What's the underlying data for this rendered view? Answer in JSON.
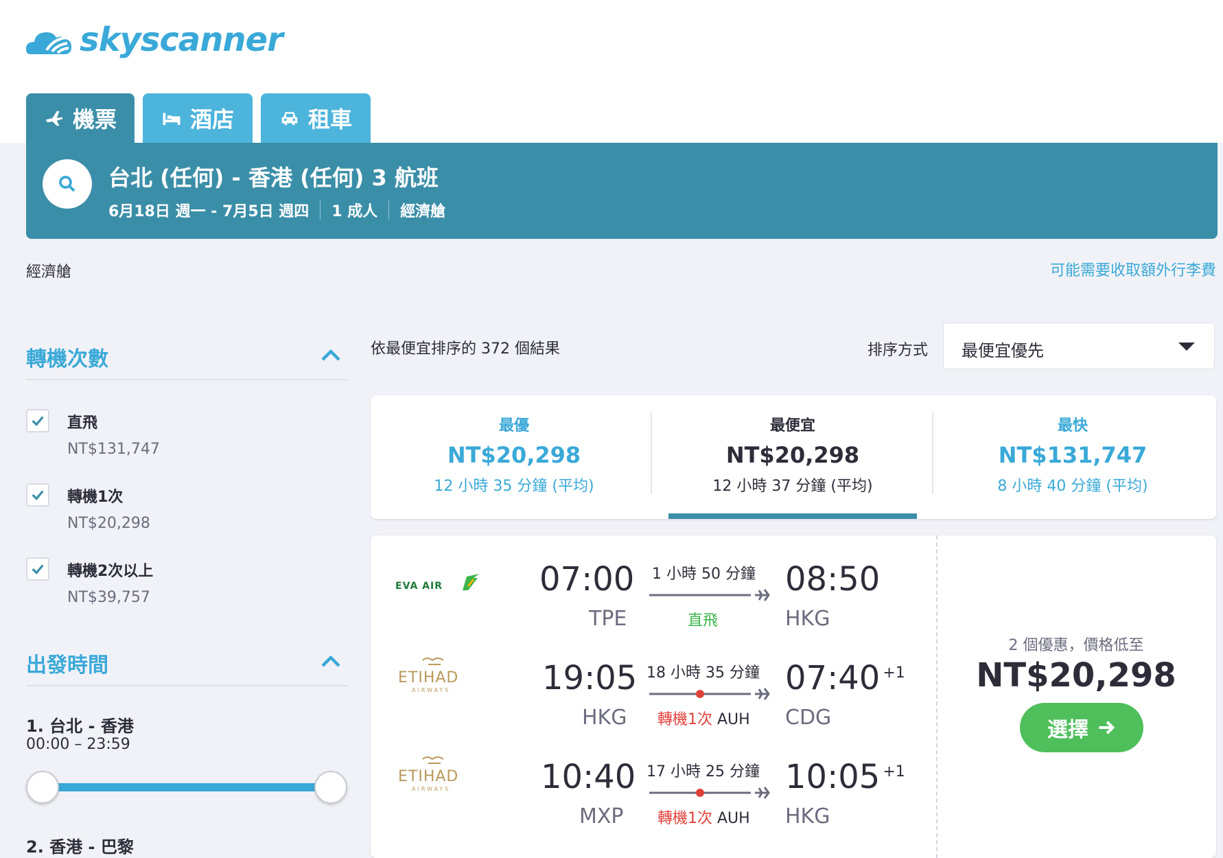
{
  "brand": {
    "name": "skyscanner",
    "color": "#3aa9d8"
  },
  "tabs": [
    {
      "label": "機票",
      "icon": "plane-icon"
    },
    {
      "label": "酒店",
      "icon": "bed-icon"
    },
    {
      "label": "租車",
      "icon": "car-icon"
    }
  ],
  "search": {
    "route": "台北 (任何) - 香港 (任何) 3 航班",
    "dates": "6月18日 週一 - 7月5日 週四",
    "passengers": "1 成人",
    "cabin": "經濟艙"
  },
  "cabin_label": "經濟艙",
  "baggage_note": "可能需要收取額外行李費",
  "filters": {
    "stops_title": "轉機次數",
    "stops": [
      {
        "label": "直飛",
        "price": "NT$131,747",
        "checked": true
      },
      {
        "label": "轉機1次",
        "price": "NT$20,298",
        "checked": true
      },
      {
        "label": "轉機2次以上",
        "price": "NT$39,757",
        "checked": true
      }
    ],
    "departure_title": "出發時間",
    "segments": [
      {
        "title": "1. 台北 - 香港",
        "range": "00:00 – 23:59"
      },
      {
        "title": "2. 香港 - 巴黎"
      }
    ]
  },
  "results": {
    "count_text": "依最便宜排序的 372 個結果",
    "sort_label": "排序方式",
    "sort_value": "最便宜優先"
  },
  "summary": [
    {
      "label": "最優",
      "price": "NT$20,298",
      "duration": "12 小時 35 分鐘 (平均)",
      "color": "#3aa9d8"
    },
    {
      "label": "最便宜",
      "price": "NT$20,298",
      "duration": "12 小時 37 分鐘 (平均)",
      "color": "#2d2d3a"
    },
    {
      "label": "最快",
      "price": "NT$131,747",
      "duration": "8 小時 40 分鐘 (平均)",
      "color": "#3aa9d8"
    }
  ],
  "itinerary": {
    "legs": [
      {
        "airline": "EVA AIR",
        "dep_time": "07:00",
        "dep_code": "TPE",
        "duration": "1 小時 50 分鐘",
        "stops": "直飛",
        "stop_airport": "",
        "arr_time": "08:50",
        "arr_code": "HKG",
        "day_offset": ""
      },
      {
        "airline": "ETIHAD",
        "dep_time": "19:05",
        "dep_code": "HKG",
        "duration": "18 小時 35 分鐘",
        "stops": "轉機1次",
        "stop_airport": "AUH",
        "arr_time": "07:40",
        "arr_code": "CDG",
        "day_offset": "+1"
      },
      {
        "airline": "ETIHAD",
        "dep_time": "10:40",
        "dep_code": "MXP",
        "duration": "17 小時 25 分鐘",
        "stops": "轉機1次",
        "stop_airport": "AUH",
        "arr_time": "10:05",
        "arr_code": "HKG",
        "day_offset": "+1"
      }
    ],
    "deals_text": "2 個優惠，價格低至",
    "price": "NT$20,298",
    "select_label": "選擇"
  }
}
